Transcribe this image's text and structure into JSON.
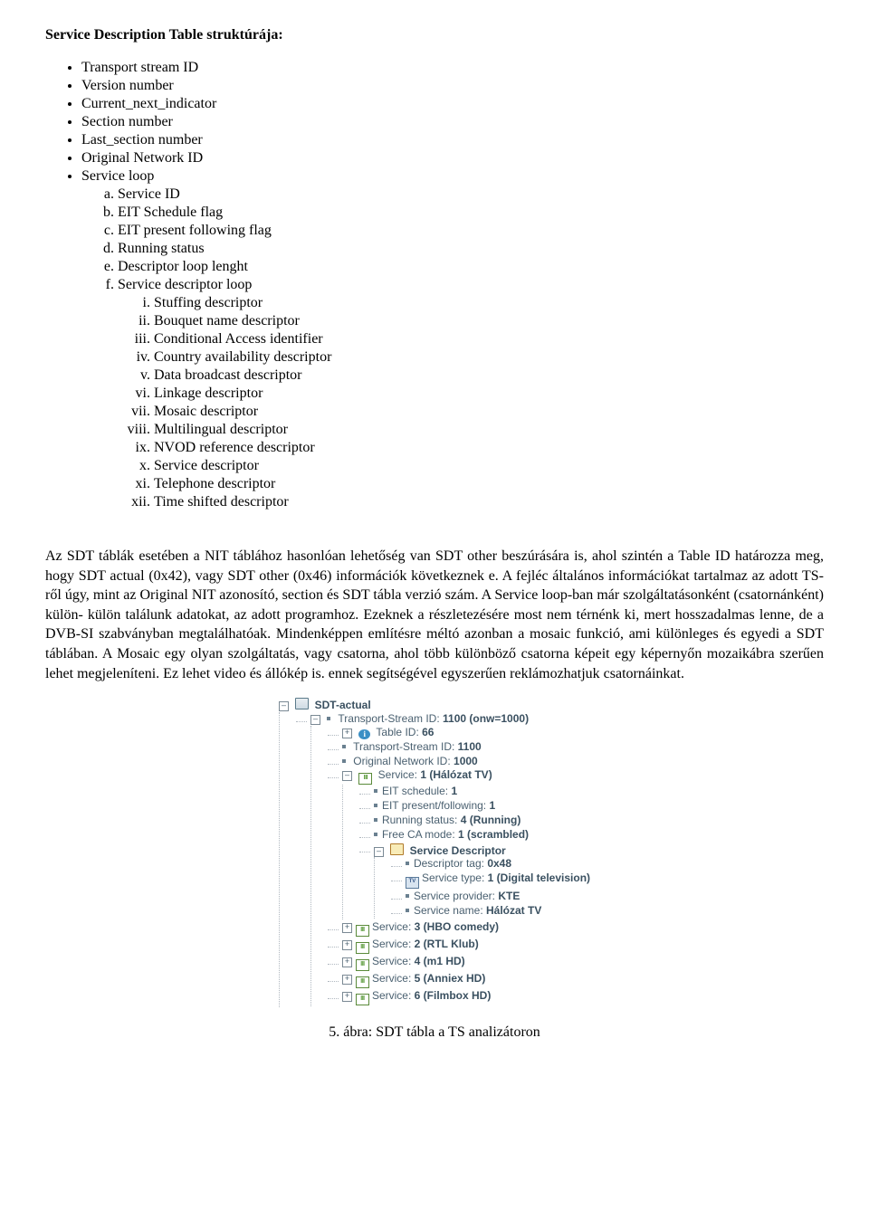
{
  "heading": "Service Description Table struktúrája:",
  "bullets": [
    "Transport stream ID",
    "Version number",
    "Current_next_indicator",
    "Section number",
    "Last_section number",
    "Original Network ID",
    "Service loop"
  ],
  "alpha": [
    "Service ID",
    "EIT Schedule flag",
    "EIT present following flag",
    "Running status",
    "Descriptor loop lenght",
    "Service descriptor loop"
  ],
  "roman": [
    "Stuffing descriptor",
    "Bouquet  name descriptor",
    "Conditional Access identifier",
    "Country availability descriptor",
    "Data broadcast descriptor",
    "Linkage descriptor",
    "Mosaic descriptor",
    "Multilingual descriptor",
    "NVOD reference descriptor",
    "Service descriptor",
    "Telephone descriptor",
    "Time shifted descriptor"
  ],
  "paragraph": "Az SDT táblák esetében a NIT táblához hasonlóan lehetőség van SDT other beszúrására is, ahol szintén a Table ID határozza meg, hogy SDT actual (0x42), vagy SDT other (0x46) információk következnek e. A fejléc általános információkat tartalmaz az adott TS-ről úgy, mint az Original NIT azonosító, section és SDT tábla verzió szám. A Service loop-ban már szolgáltatásonként (csatornánként) külön- külön találunk adatokat, az adott programhoz. Ezeknek a részletezésére most nem térnénk ki, mert hosszadalmas lenne, de a DVB-SI szabványban megtalálhatóak. Mindenképpen említésre méltó azonban a mosaic funkció, ami különleges és egyedi a SDT táblában. A Mosaic egy olyan szolgáltatás, vagy csatorna, ahol több különböző csatorna képeit egy képernyőn mozaikábra szerűen lehet megjeleníteni. Ez lehet video és állókép is. ennek segítségével egyszerűen reklámozhatjuk csatornáinkat.",
  "tree": {
    "root_label": "SDT-actual",
    "n1": {
      "k": "Transport-Stream ID:",
      "v": "1100 (onw=1000)"
    },
    "n2": {
      "k": "Table ID:",
      "v": "66"
    },
    "n3": {
      "k": "Transport-Stream ID:",
      "v": "1100"
    },
    "n4": {
      "k": "Original Network ID:",
      "v": "1000"
    },
    "svc1": {
      "k": "Service:",
      "v": "1 (Hálózat TV)"
    },
    "svc1_items": {
      "eit_sched": {
        "k": "EIT schedule:",
        "v": "1"
      },
      "eit_pf": {
        "k": "EIT present/following:",
        "v": "1"
      },
      "running": {
        "k": "Running status:",
        "v": "4 (Running)"
      },
      "ca": {
        "k": "Free CA mode:",
        "v": "1 (scrambled)"
      },
      "desc_label": "Service Descriptor",
      "tag": {
        "k": "Descriptor tag:",
        "v": "0x48"
      },
      "stype": {
        "k": "Service type:",
        "v": "1 (Digital television)"
      },
      "prov": {
        "k": "Service provider:",
        "v": "KTE"
      },
      "sname": {
        "k": "Service name:",
        "v": "Hálózat TV"
      }
    },
    "svc3": {
      "k": "Service:",
      "v": "3 (HBO comedy)"
    },
    "svc2": {
      "k": "Service:",
      "v": "2 (RTL Klub)"
    },
    "svc4": {
      "k": "Service:",
      "v": "4 (m1 HD)"
    },
    "svc5": {
      "k": "Service:",
      "v": "5 (Anniex HD)"
    },
    "svc6": {
      "k": "Service:",
      "v": "6 (Filmbox HD)"
    }
  },
  "caption": "5. ábra: SDT tábla a TS analizátoron"
}
